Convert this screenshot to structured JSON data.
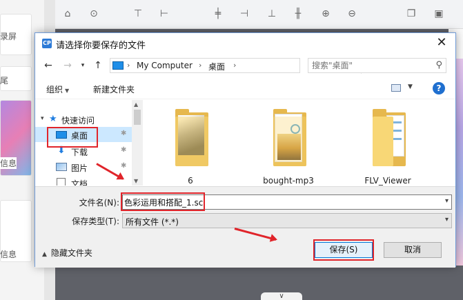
{
  "background": {
    "left_labels": [
      "录屏",
      "尾",
      "信息",
      "信息"
    ],
    "toolbar_icons": [
      "home-icon",
      "more-icon",
      "align-top-icon",
      "align-left-icon",
      "align-center-icon",
      "align-right-icon",
      "align-bottom-icon",
      "distribute-icon",
      "zoom-in-icon",
      "zoom-out-icon",
      "copy-icon",
      "delete-icon"
    ],
    "bottom_handle": "∨"
  },
  "dialog": {
    "title": "请选择你要保存的文件",
    "close_label": "✕",
    "address": {
      "segments": [
        "My Computer",
        "桌面"
      ]
    },
    "search": {
      "placeholder": "搜索\"桌面\""
    },
    "commands": {
      "organize": "组织",
      "new_folder": "新建文件夹"
    },
    "help_label": "?",
    "nav_pane": {
      "quick_access": "快速访问",
      "items": [
        {
          "label": "桌面",
          "selected": true
        },
        {
          "label": "下载",
          "selected": false
        },
        {
          "label": "图片",
          "selected": false
        },
        {
          "label": "文档",
          "selected": false
        }
      ]
    },
    "files": [
      {
        "name": "6"
      },
      {
        "name": "bought-mp3"
      },
      {
        "name": "FLV_Viewer"
      }
    ],
    "filename_label": "文件名(N):",
    "filename_value": "色彩运用和搭配_1.sc",
    "filetype_label": "保存类型(T):",
    "filetype_value": "所有文件 (*.*)",
    "hide_folders": "隐藏文件夹",
    "save_button": "保存(S)",
    "cancel_button": "取消"
  },
  "colors": {
    "annotation_red": "#e0242a",
    "selection_blue": "#cce8ff",
    "accent_blue": "#0078d7"
  }
}
